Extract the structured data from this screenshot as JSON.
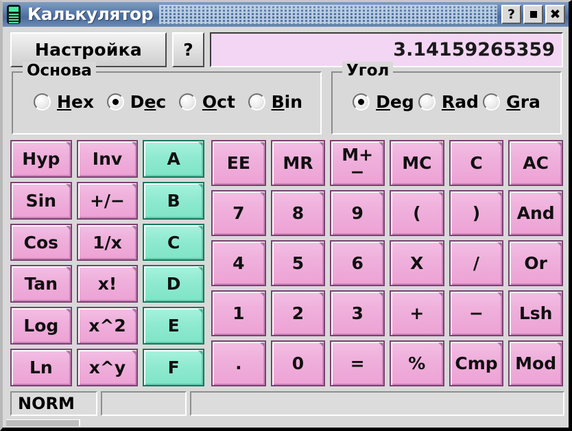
{
  "window": {
    "title": "Калькулятор",
    "icon": "calculator-icon",
    "controls": [
      {
        "name": "help-button",
        "label": "?"
      },
      {
        "name": "maximize-button",
        "label": ""
      },
      {
        "name": "close-button",
        "label": "✖"
      }
    ]
  },
  "toolbar": {
    "settings_label": "Настройка",
    "help_label": "?"
  },
  "display": {
    "value": "3.14159265359"
  },
  "base_group": {
    "title": "Основа",
    "options": [
      {
        "pre": "",
        "mnemonic": "H",
        "post": "ex",
        "checked": false,
        "name": "radio-hex"
      },
      {
        "pre": "D",
        "mnemonic": "e",
        "post": "c",
        "checked": true,
        "name": "radio-dec"
      },
      {
        "pre": "",
        "mnemonic": "O",
        "post": "ct",
        "checked": false,
        "name": "radio-oct"
      },
      {
        "pre": "",
        "mnemonic": "B",
        "post": "in",
        "checked": false,
        "name": "radio-bin"
      }
    ]
  },
  "angle_group": {
    "title": "Угол",
    "options": [
      {
        "pre": "",
        "mnemonic": "D",
        "post": "eg",
        "checked": true,
        "name": "radio-deg"
      },
      {
        "pre": "",
        "mnemonic": "R",
        "post": "ad",
        "checked": false,
        "name": "radio-rad"
      },
      {
        "pre": "",
        "mnemonic": "G",
        "post": "ra",
        "checked": false,
        "name": "radio-gra"
      }
    ]
  },
  "keypad_left": [
    {
      "label": "Hyp",
      "style": "func",
      "name": "key-hyp"
    },
    {
      "label": "Inv",
      "style": "func",
      "name": "key-inv"
    },
    {
      "label": "A",
      "style": "hex",
      "name": "key-a"
    },
    {
      "label": "Sin",
      "style": "func",
      "name": "key-sin"
    },
    {
      "label": "+/−",
      "style": "func",
      "name": "key-plus-minus"
    },
    {
      "label": "B",
      "style": "hex",
      "name": "key-b"
    },
    {
      "label": "Cos",
      "style": "func",
      "name": "key-cos"
    },
    {
      "label": "1/x",
      "style": "func",
      "name": "key-reciprocal"
    },
    {
      "label": "C",
      "style": "hex",
      "name": "key-c-hex"
    },
    {
      "label": "Tan",
      "style": "func",
      "name": "key-tan"
    },
    {
      "label": "x!",
      "style": "func",
      "name": "key-factorial"
    },
    {
      "label": "D",
      "style": "hex",
      "name": "key-d"
    },
    {
      "label": "Log",
      "style": "func",
      "name": "key-log"
    },
    {
      "label": "x^2",
      "style": "func",
      "name": "key-square"
    },
    {
      "label": "E",
      "style": "hex",
      "name": "key-e"
    },
    {
      "label": "Ln",
      "style": "func",
      "name": "key-ln"
    },
    {
      "label": "x^y",
      "style": "func",
      "name": "key-power"
    },
    {
      "label": "F",
      "style": "hex",
      "name": "key-f"
    }
  ],
  "keypad_right": [
    {
      "label": "EE",
      "style": "func",
      "name": "key-ee"
    },
    {
      "label": "MR",
      "style": "func",
      "name": "key-mr"
    },
    {
      "label": "M+−",
      "style": "func",
      "name": "key-m-plus-minus"
    },
    {
      "label": "MC",
      "style": "func",
      "name": "key-mc"
    },
    {
      "label": "C",
      "style": "func",
      "name": "key-clear"
    },
    {
      "label": "AC",
      "style": "func",
      "name": "key-all-clear"
    },
    {
      "label": "7",
      "style": "func",
      "name": "key-7"
    },
    {
      "label": "8",
      "style": "func",
      "name": "key-8"
    },
    {
      "label": "9",
      "style": "func",
      "name": "key-9"
    },
    {
      "label": "(",
      "style": "func",
      "name": "key-paren-open"
    },
    {
      "label": ")",
      "style": "func",
      "name": "key-paren-close"
    },
    {
      "label": "And",
      "style": "func",
      "name": "key-and"
    },
    {
      "label": "4",
      "style": "func",
      "name": "key-4"
    },
    {
      "label": "5",
      "style": "func",
      "name": "key-5"
    },
    {
      "label": "6",
      "style": "func",
      "name": "key-6"
    },
    {
      "label": "X",
      "style": "func",
      "name": "key-multiply"
    },
    {
      "label": "/",
      "style": "func",
      "name": "key-divide"
    },
    {
      "label": "Or",
      "style": "func",
      "name": "key-or"
    },
    {
      "label": "1",
      "style": "func",
      "name": "key-1"
    },
    {
      "label": "2",
      "style": "func",
      "name": "key-2"
    },
    {
      "label": "3",
      "style": "func",
      "name": "key-3"
    },
    {
      "label": "+",
      "style": "func",
      "name": "key-add"
    },
    {
      "label": "−",
      "style": "func",
      "name": "key-subtract"
    },
    {
      "label": "Lsh",
      "style": "func",
      "name": "key-left-shift"
    },
    {
      "label": ".",
      "style": "func",
      "name": "key-decimal"
    },
    {
      "label": "0",
      "style": "func",
      "name": "key-0"
    },
    {
      "label": "=",
      "style": "func",
      "name": "key-equals"
    },
    {
      "label": "%",
      "style": "func",
      "name": "key-percent"
    },
    {
      "label": "Cmp",
      "style": "func",
      "name": "key-complement"
    },
    {
      "label": "Mod",
      "style": "func",
      "name": "key-mod"
    }
  ],
  "statusbar": {
    "panels": [
      {
        "text": "NORM",
        "name": "status-mode"
      },
      {
        "text": "",
        "name": "status-secondary"
      },
      {
        "text": "",
        "name": "status-message"
      }
    ]
  },
  "colors": {
    "titlebar_blue": "#5d7fad",
    "window_face": "#d9d9d9",
    "display_bg": "#f3d6f3",
    "key_pink": "#efb0dc",
    "key_pink_border": "#7c3f72",
    "key_hex_teal": "#8fead0",
    "key_hex_border": "#13785c"
  }
}
